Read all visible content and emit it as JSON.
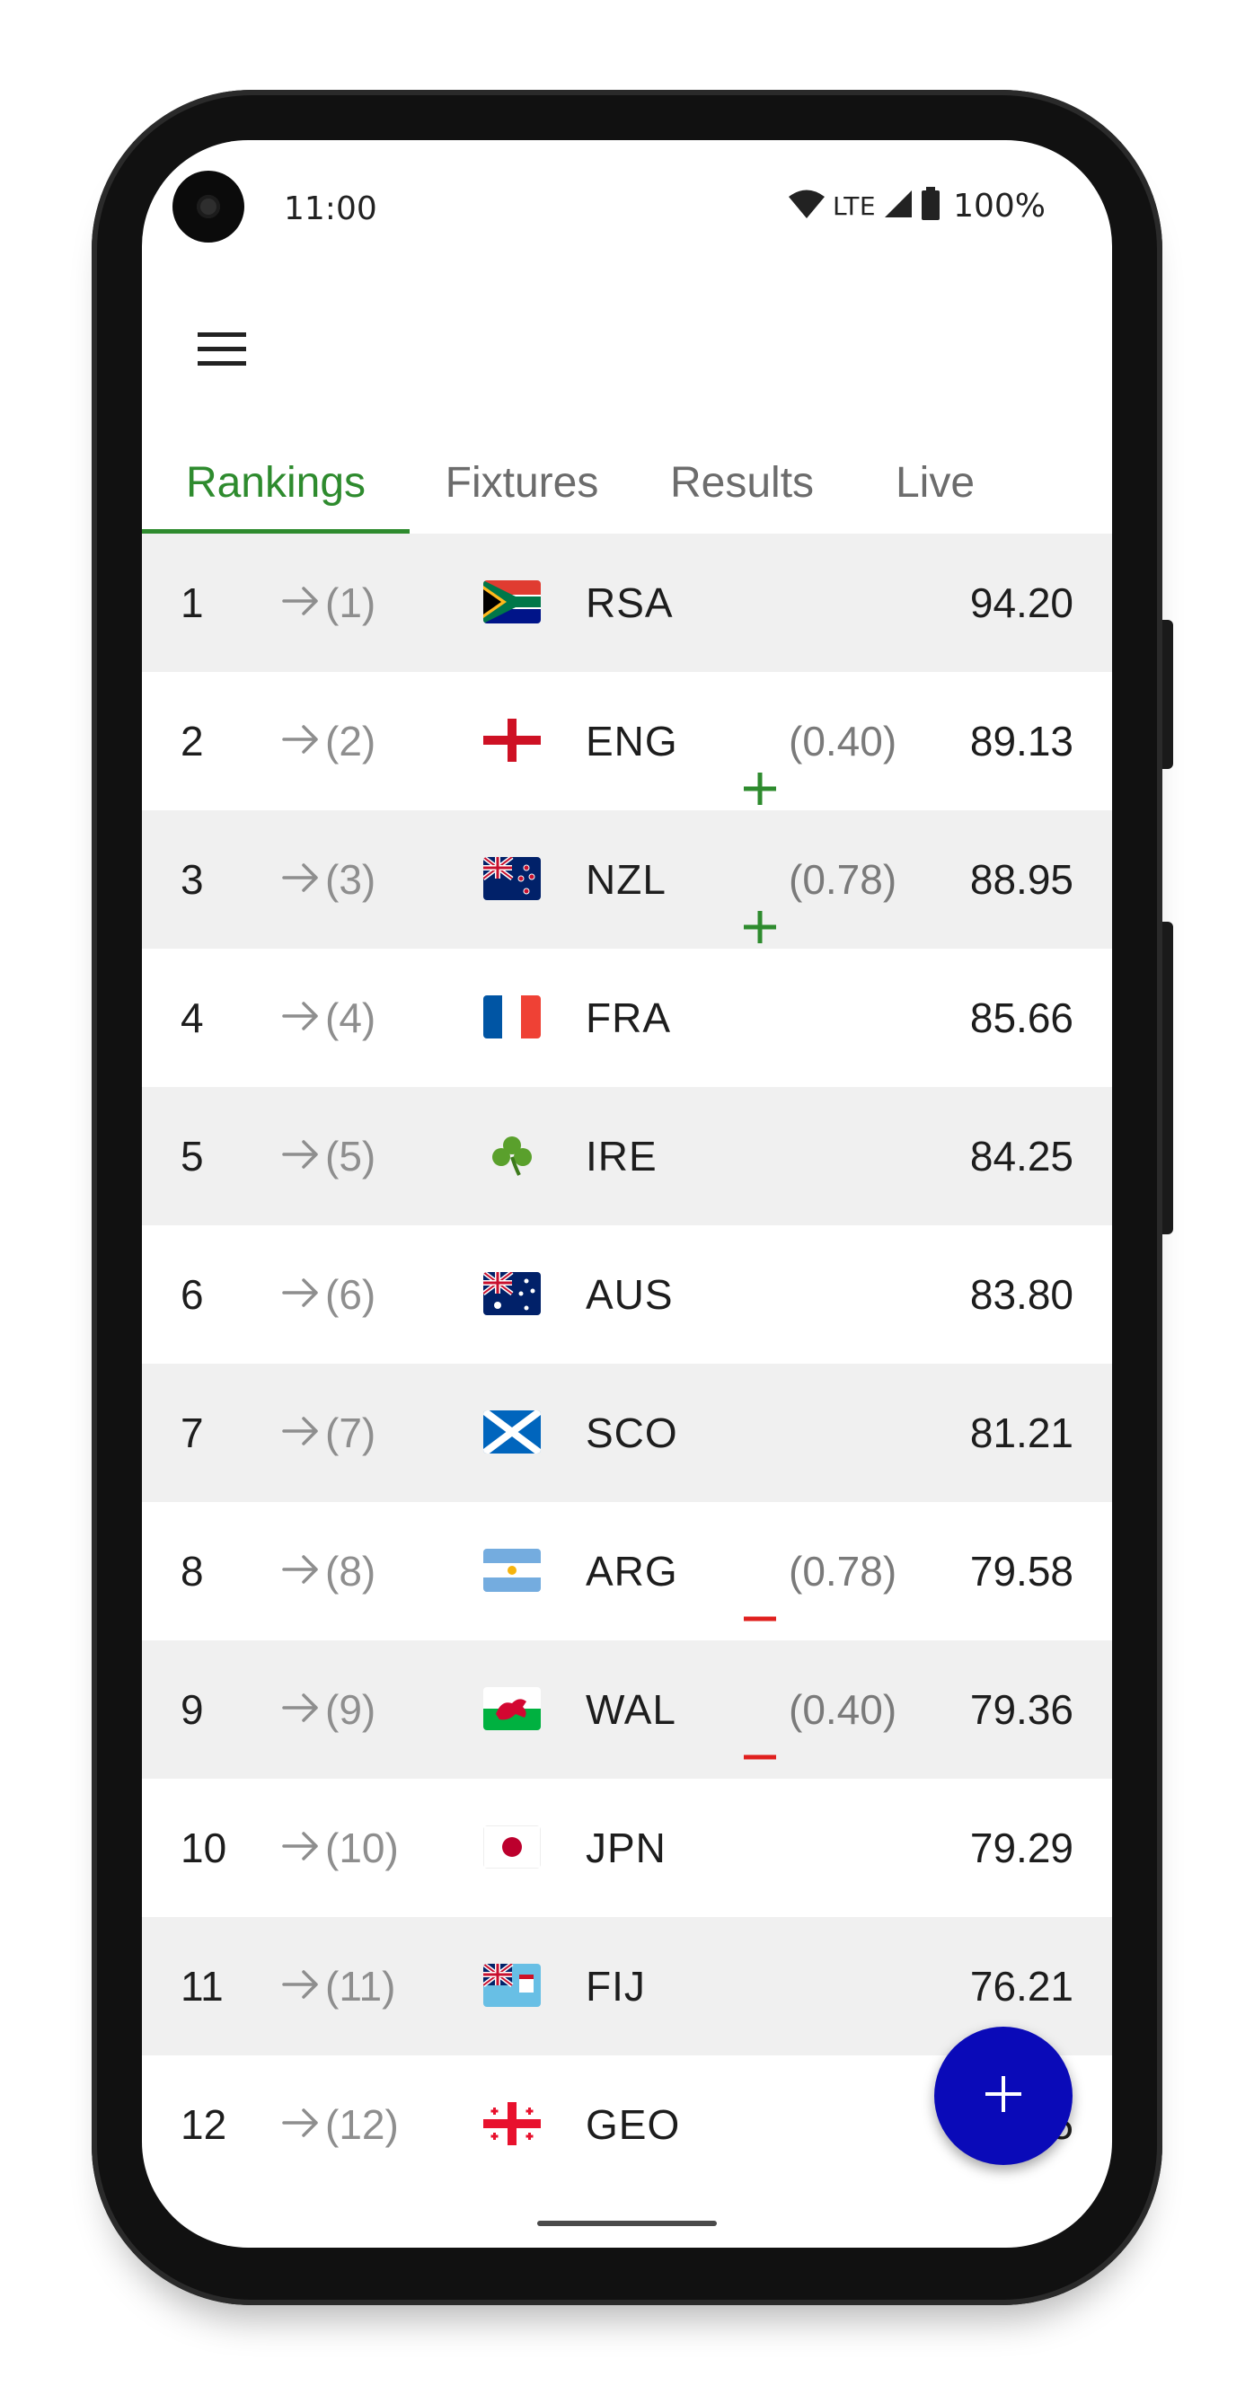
{
  "status_bar": {
    "time": "11:00",
    "network": "LTE",
    "battery": "100%"
  },
  "tabs": [
    {
      "label": "Rankings",
      "active": true
    },
    {
      "label": "Fixtures",
      "active": false
    },
    {
      "label": "Results",
      "active": false
    },
    {
      "label": "Live",
      "active": false
    }
  ],
  "colors": {
    "accent": "#2e8b2e",
    "up": "#2e8b2e",
    "down": "#e0201e",
    "fab": "#0a0ab8",
    "row_shade": "#f0f0f0"
  },
  "rankings": [
    {
      "rank": "1",
      "previous": "(1)",
      "team": "RSA",
      "flag": "south-africa-flag",
      "change": "",
      "trend": "none",
      "points": "94.20"
    },
    {
      "rank": "2",
      "previous": "(2)",
      "team": "ENG",
      "flag": "england-flag",
      "change": "(0.40)",
      "trend": "up",
      "points": "89.13"
    },
    {
      "rank": "3",
      "previous": "(3)",
      "team": "NZL",
      "flag": "new-zealand-flag",
      "change": "(0.78)",
      "trend": "up",
      "points": "88.95"
    },
    {
      "rank": "4",
      "previous": "(4)",
      "team": "FRA",
      "flag": "france-flag",
      "change": "",
      "trend": "none",
      "points": "85.66"
    },
    {
      "rank": "5",
      "previous": "(5)",
      "team": "IRE",
      "flag": "shamrock-icon",
      "change": "",
      "trend": "none",
      "points": "84.25"
    },
    {
      "rank": "6",
      "previous": "(6)",
      "team": "AUS",
      "flag": "australia-flag",
      "change": "",
      "trend": "none",
      "points": "83.80"
    },
    {
      "rank": "7",
      "previous": "(7)",
      "team": "SCO",
      "flag": "scotland-flag",
      "change": "",
      "trend": "none",
      "points": "81.21"
    },
    {
      "rank": "8",
      "previous": "(8)",
      "team": "ARG",
      "flag": "argentina-flag",
      "change": "(0.78)",
      "trend": "down",
      "points": "79.58"
    },
    {
      "rank": "9",
      "previous": "(9)",
      "team": "WAL",
      "flag": "wales-flag",
      "change": "(0.40)",
      "trend": "down",
      "points": "79.36"
    },
    {
      "rank": "10",
      "previous": "(10)",
      "team": "JPN",
      "flag": "japan-flag",
      "change": "",
      "trend": "none",
      "points": "79.29"
    },
    {
      "rank": "11",
      "previous": "(11)",
      "team": "FIJ",
      "flag": "fiji-flag",
      "change": "",
      "trend": "none",
      "points": "76.21"
    },
    {
      "rank": "12",
      "previous": "(12)",
      "team": "GEO",
      "flag": "georgia-flag",
      "change": "",
      "trend": "none",
      "points": "5"
    }
  ],
  "fab": {
    "icon": "plus-icon"
  }
}
